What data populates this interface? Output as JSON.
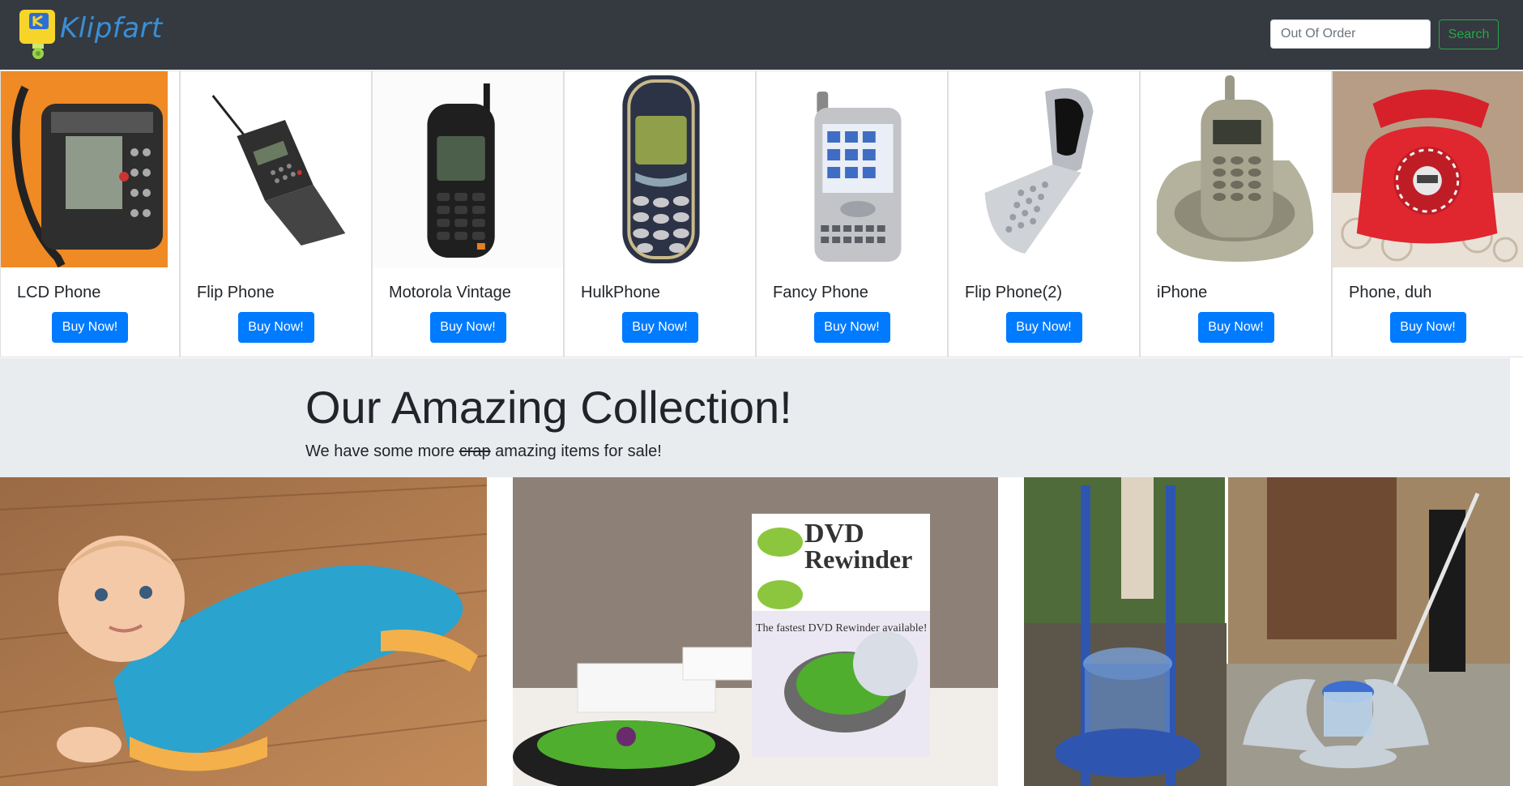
{
  "navbar": {
    "brand": "Klipfart",
    "search_placeholder": "Out Of Order",
    "search_button": "Search"
  },
  "products": [
    {
      "name": "LCD Phone",
      "button": "Buy Now!"
    },
    {
      "name": "Flip Phone",
      "button": "Buy Now!"
    },
    {
      "name": "Motorola Vintage",
      "button": "Buy Now!"
    },
    {
      "name": "HulkPhone",
      "button": "Buy Now!"
    },
    {
      "name": "Fancy Phone",
      "button": "Buy Now!"
    },
    {
      "name": "Flip Phone(2)",
      "button": "Buy Now!"
    },
    {
      "name": "iPhone",
      "button": "Buy Now!"
    },
    {
      "name": "Phone, duh",
      "button": "Buy Now!"
    }
  ],
  "jumbotron": {
    "title": "Our Amazing Collection!",
    "lead_before": "We have some more ",
    "lead_strike": "crap",
    "lead_after": " amazing items for sale!"
  },
  "gallery": {
    "dvd_box_brand": "DVD",
    "dvd_box_product": "Rewinder",
    "dvd_box_tagline": "The fastest DVD Rewinder available!"
  },
  "colors": {
    "navbar_bg": "#343a40",
    "primary": "#007bff",
    "success": "#28a745",
    "jumbotron_bg": "#e9ecef"
  }
}
